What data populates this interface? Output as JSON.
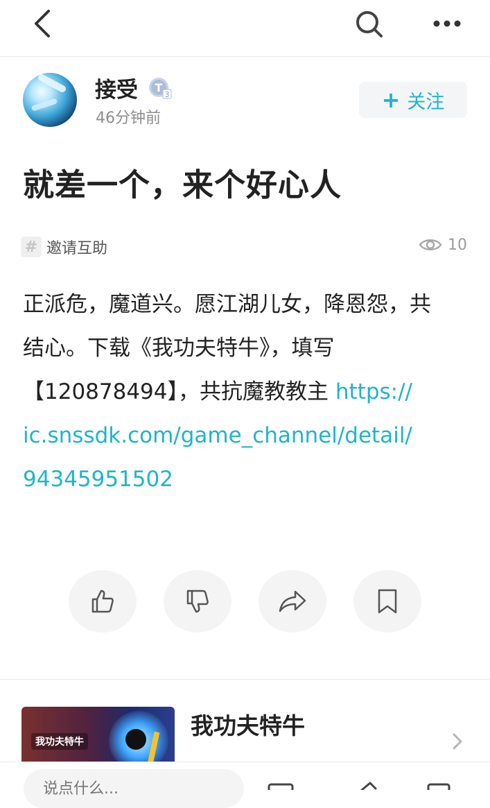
{
  "nav": {
    "back_icon": "chevron-left-icon",
    "search_icon": "search-icon",
    "more_icon": "more-horizontal-icon"
  },
  "author": {
    "name": "接受",
    "level_badge": "T3",
    "time": "46分钟前",
    "follow_label": "关注"
  },
  "post": {
    "title": "就差一个，来个好心人",
    "topic": "邀请互助",
    "views": "10",
    "body_lines": [
      "正派危，魔道兴。愿江湖儿女，降恩怨，共",
      "结心。下载《我功夫特牛》，填写",
      "【120878494】，共抗魔教教主 "
    ],
    "link_line_1": "https://",
    "link_line_2": "ic.snssdk.com/game_channel/detail/",
    "link_line_3": "94345951502"
  },
  "actions": [
    {
      "icon": "thumbs-up-icon"
    },
    {
      "icon": "thumbs-down-icon"
    },
    {
      "icon": "share-icon"
    },
    {
      "icon": "bookmark-icon"
    }
  ],
  "game_card": {
    "name": "我功夫特牛",
    "thumb_label": "我功夫特牛"
  },
  "bottom_bar": {
    "comment_placeholder": "说点什么..."
  },
  "colors": {
    "accent": "#1fb5c9",
    "text": "#222222",
    "muted": "#8d8d8d"
  }
}
